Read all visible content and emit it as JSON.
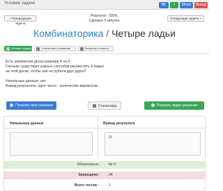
{
  "header": {
    "title": "Условие задачи",
    "buttons": [
      "В6",
      "+",
      "Меню",
      "Выход"
    ]
  },
  "pager": {
    "prev_label": "« Предыдущая задача",
    "next_label": "Следующая задача »",
    "result_label": "Результат: 100%.",
    "attempts_label": "Сделано 3 запуска."
  },
  "problem_title": {
    "section": "Комбинаторика",
    "separator": "/",
    "name": "Четыре ладьи"
  },
  "tabs": [
    {
      "label": "Условие задачи",
      "active": true
    },
    {
      "label": "Статистика и решения",
      "active": false
    },
    {
      "label": "Вопросы и ответы",
      "active": false
    }
  ],
  "statement": {
    "lines": [
      "Есть шахматная доска размера 4 на 4.",
      "Сколько существует разных способов расместить 4 ладьи",
      "на этой доске, чтобы они не рубили друг друга?"
    ],
    "input_note": "Начальные данные: нет.",
    "output_note": "Вывод результата: одно число - количество вариантов."
  },
  "actions": {
    "show_solution": "Показать моё решение",
    "stats": "Статистика",
    "video": "Показать видео-решение"
  },
  "io": {
    "input_header": "Начальные данные",
    "output_header": "Вывод результата",
    "input_value": "-",
    "output_value": "24"
  },
  "checks": {
    "required_label": "Обязательно:",
    "required_value": "for if",
    "forbidden_label": "Запрещено:",
    "forbidden_value": "24",
    "total_label": "Всего тестов :",
    "total_value": "1"
  },
  "colors": {
    "accent": "#2a83c6",
    "primary_button": "#3a7bd5",
    "success": "#3aa657",
    "danger": "#d9534f",
    "required_row": "#dff0d8",
    "forbidden_row": "#f2dede"
  }
}
